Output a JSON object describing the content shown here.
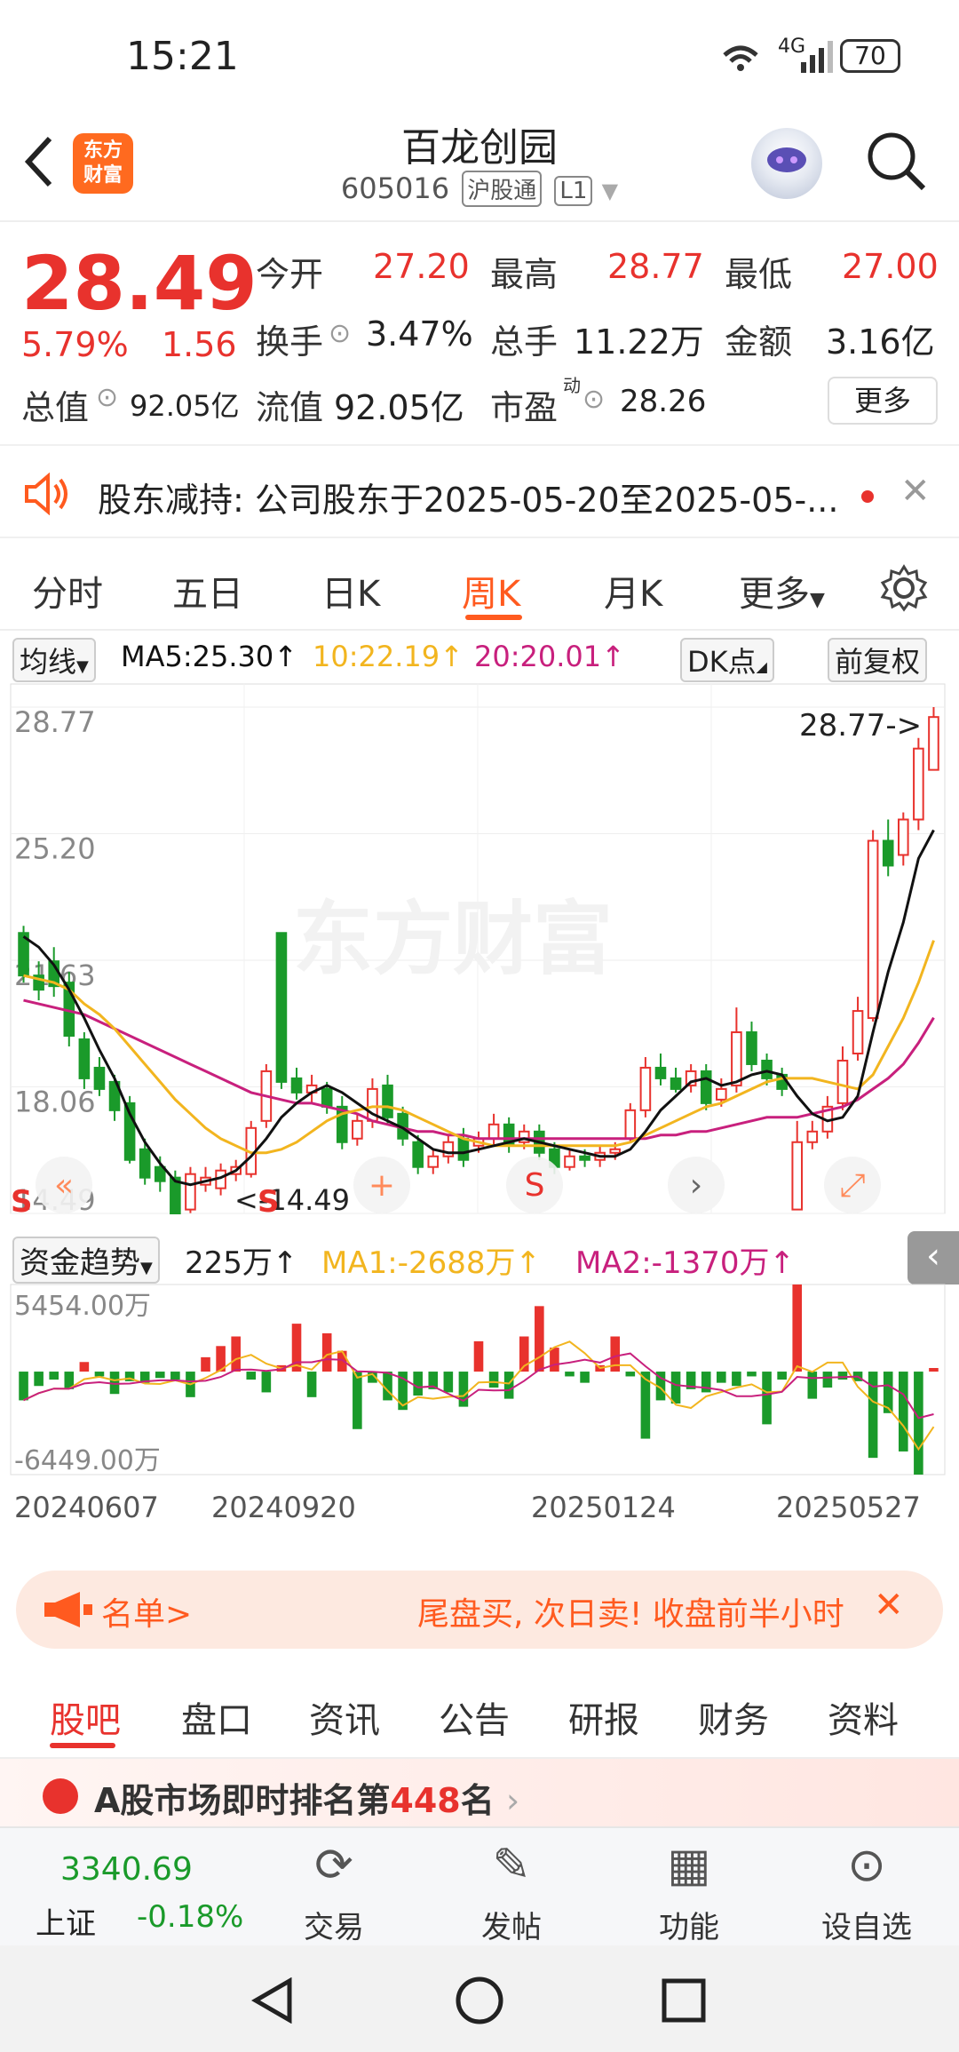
{
  "status": {
    "time": "15:21",
    "network": "4G",
    "battery": "70"
  },
  "header": {
    "logo_text_1": "东方",
    "logo_text_2": "财富",
    "title": "百龙创园",
    "code": "605016",
    "tag1": "沪股通",
    "tag2": "L1"
  },
  "quote": {
    "price": "28.49",
    "change_pct": "5.79%",
    "change": "1.56",
    "open_label": "今开",
    "open": "27.20",
    "high_label": "最高",
    "high": "28.77",
    "low_label": "最低",
    "low": "27.00",
    "turnover_label": "换手",
    "turnover": "3.47%",
    "volume_label": "总手",
    "volume": "11.22万",
    "amount_label": "金额",
    "amount": "3.16亿",
    "mcap_label": "总值",
    "mcap": "92.05亿",
    "float_label": "流值",
    "float": "92.05亿",
    "pe_label": "市盈",
    "pe_sup": "动",
    "pe": "28.26",
    "more": "更多"
  },
  "notice": {
    "text": "股东减持:   公司股东于2025-05-20至2025-05-..."
  },
  "ktabs": [
    "分时",
    "五日",
    "日K",
    "周K",
    "月K",
    "更多"
  ],
  "chart_header": {
    "ma_label": "均线",
    "ma5": "MA5:25.30↑",
    "ma10": "10:22.19↑",
    "ma20": "20:20.01↑",
    "dk": "DK点",
    "adj": "前复权"
  },
  "chart_data": [
    {
      "type": "candlestick",
      "y_axis_labels": [
        "28.77",
        "25.20",
        "21.63",
        "18.06",
        "14.49"
      ],
      "ylim": [
        14.49,
        28.77
      ],
      "annotations": [
        "28.77->",
        "<-14.49"
      ],
      "x_labels": [
        "20240607",
        "20240920",
        "20250124",
        "20250527"
      ],
      "candles": [
        [
          22.4,
          21.2,
          22.6,
          21.0
        ],
        [
          21.2,
          20.8,
          21.6,
          20.5
        ],
        [
          21.6,
          20.9,
          22.0,
          20.6
        ],
        [
          21.0,
          19.5,
          21.3,
          19.2
        ],
        [
          19.4,
          18.3,
          19.6,
          18.0
        ],
        [
          18.6,
          18.0,
          18.9,
          17.8
        ],
        [
          18.2,
          17.4,
          18.4,
          17.1
        ],
        [
          17.6,
          16.0,
          17.8,
          15.9
        ],
        [
          16.3,
          15.5,
          16.6,
          15.3
        ],
        [
          15.8,
          15.4,
          16.1,
          15.1
        ],
        [
          15.5,
          14.49,
          15.7,
          14.49
        ],
        [
          14.6,
          15.6,
          15.8,
          14.5
        ],
        [
          15.3,
          15.5,
          15.8,
          15.1
        ],
        [
          15.2,
          15.7,
          15.9,
          15.0
        ],
        [
          15.6,
          15.8,
          16.0,
          15.4
        ],
        [
          15.6,
          16.9,
          17.1,
          15.5
        ],
        [
          17.1,
          18.5,
          18.7,
          16.9
        ],
        [
          22.4,
          18.2,
          22.4,
          18.0
        ],
        [
          18.3,
          17.9,
          18.6,
          17.7
        ],
        [
          17.9,
          18.1,
          18.4,
          17.6
        ],
        [
          18.0,
          17.5,
          18.2,
          17.3
        ],
        [
          17.5,
          16.5,
          17.8,
          16.3
        ],
        [
          16.6,
          17.1,
          17.3,
          16.4
        ],
        [
          17.1,
          18.0,
          18.3,
          16.9
        ],
        [
          18.1,
          17.2,
          18.4,
          17.0
        ],
        [
          17.3,
          16.6,
          17.5,
          16.4
        ],
        [
          16.5,
          15.8,
          16.7,
          15.6
        ],
        [
          15.8,
          16.1,
          16.3,
          15.6
        ],
        [
          16.1,
          16.5,
          16.7,
          15.9
        ],
        [
          16.6,
          16.0,
          16.9,
          15.8
        ],
        [
          16.4,
          16.6,
          16.8,
          16.2
        ],
        [
          16.6,
          17.0,
          17.3,
          16.4
        ],
        [
          17.0,
          16.4,
          17.2,
          16.2
        ],
        [
          16.5,
          16.8,
          17.0,
          16.3
        ],
        [
          16.8,
          16.2,
          17.0,
          16.0
        ],
        [
          16.3,
          15.8,
          16.5,
          15.6
        ],
        [
          15.8,
          16.1,
          16.3,
          15.7
        ],
        [
          16.1,
          16.0,
          16.3,
          15.8
        ],
        [
          16.0,
          16.2,
          16.4,
          15.8
        ],
        [
          16.2,
          16.3,
          16.5,
          16.0
        ],
        [
          16.6,
          17.4,
          17.6,
          16.5
        ],
        [
          17.4,
          18.6,
          18.9,
          17.2
        ],
        [
          18.6,
          18.3,
          19.0,
          18.1
        ],
        [
          18.3,
          18.0,
          18.6,
          17.9
        ],
        [
          18.1,
          18.5,
          18.7,
          17.9
        ],
        [
          18.5,
          17.6,
          18.7,
          17.4
        ],
        [
          17.7,
          18.0,
          18.3,
          17.5
        ],
        [
          18.1,
          19.6,
          20.3,
          17.9
        ],
        [
          19.6,
          18.7,
          19.9,
          18.5
        ],
        [
          18.8,
          18.3,
          19.0,
          18.1
        ],
        [
          18.4,
          18.0,
          18.6,
          17.8
        ],
        [
          14.6,
          16.5,
          17.1,
          14.6
        ],
        [
          16.5,
          16.8,
          17.1,
          16.3
        ],
        [
          16.8,
          17.5,
          17.8,
          16.6
        ],
        [
          17.6,
          18.8,
          19.2,
          17.4
        ],
        [
          19.0,
          20.2,
          20.6,
          18.8
        ],
        [
          20.0,
          25.0,
          25.3,
          19.9
        ],
        [
          25.0,
          24.3,
          25.6,
          24.0
        ],
        [
          24.6,
          25.6,
          25.8,
          24.3
        ],
        [
          25.6,
          27.6,
          27.9,
          25.3
        ],
        [
          27.0,
          28.49,
          28.77,
          27.0
        ]
      ],
      "ma5": [
        22.3,
        22.0,
        21.5,
        20.8,
        20.0,
        19.1,
        18.3,
        17.3,
        16.5,
        15.9,
        15.4,
        15.3,
        15.4,
        15.5,
        15.7,
        16.1,
        16.6,
        17.2,
        17.6,
        17.9,
        18.1,
        17.9,
        17.6,
        17.3,
        17.1,
        16.9,
        16.6,
        16.3,
        16.2,
        16.2,
        16.3,
        16.4,
        16.5,
        16.6,
        16.5,
        16.4,
        16.3,
        16.2,
        16.1,
        16.1,
        16.3,
        16.8,
        17.4,
        17.8,
        18.2,
        18.3,
        18.1,
        18.2,
        18.4,
        18.5,
        18.4,
        17.8,
        17.3,
        17.1,
        17.2,
        17.8,
        19.6,
        21.3,
        22.7,
        24.5,
        25.3
      ],
      "ma10": [
        21.2,
        21.1,
        21.0,
        20.8,
        20.4,
        20.1,
        19.7,
        19.2,
        18.7,
        18.2,
        17.7,
        17.3,
        16.9,
        16.6,
        16.4,
        16.2,
        16.2,
        16.3,
        16.5,
        16.8,
        17.1,
        17.3,
        17.4,
        17.5,
        17.5,
        17.4,
        17.2,
        17.0,
        16.8,
        16.6,
        16.5,
        16.4,
        16.4,
        16.4,
        16.4,
        16.4,
        16.4,
        16.4,
        16.4,
        16.4,
        16.5,
        16.7,
        16.9,
        17.1,
        17.3,
        17.5,
        17.6,
        17.8,
        18.0,
        18.2,
        18.3,
        18.3,
        18.3,
        18.2,
        18.1,
        18.0,
        18.4,
        19.2,
        20.0,
        21.0,
        22.19
      ],
      "ma20": [
        20.5,
        20.4,
        20.3,
        20.2,
        20.1,
        19.9,
        19.7,
        19.5,
        19.3,
        19.1,
        18.9,
        18.7,
        18.5,
        18.3,
        18.1,
        17.9,
        17.8,
        17.7,
        17.6,
        17.6,
        17.5,
        17.4,
        17.3,
        17.1,
        17.0,
        16.9,
        16.8,
        16.8,
        16.7,
        16.7,
        16.6,
        16.6,
        16.6,
        16.6,
        16.6,
        16.6,
        16.6,
        16.6,
        16.6,
        16.6,
        16.6,
        16.6,
        16.7,
        16.7,
        16.8,
        16.8,
        16.9,
        17.0,
        17.1,
        17.2,
        17.2,
        17.2,
        17.3,
        17.4,
        17.5,
        17.7,
        18.0,
        18.3,
        18.7,
        19.3,
        20.01
      ]
    },
    {
      "type": "bar",
      "name": "资金趋势",
      "value_label": "225万↑",
      "ma1": "MA1:-2688万↑",
      "ma2": "MA2:-1370万↑",
      "y_axis_labels": [
        "5454.00万",
        "-6449.00万"
      ],
      "ylim": [
        -6449,
        5454
      ],
      "values": [
        -1800,
        -900,
        -500,
        -1100,
        600,
        -300,
        -1400,
        -600,
        -700,
        -400,
        -500,
        -1600,
        900,
        1600,
        2200,
        -500,
        -1300,
        400,
        3000,
        -1600,
        2400,
        1300,
        -3600,
        -700,
        -1800,
        -2400,
        -1500,
        -1100,
        -1300,
        -2200,
        1900,
        -1000,
        -1700,
        2200,
        4100,
        1500,
        -300,
        -700,
        400,
        2200,
        -300,
        -4200,
        -1800,
        -2000,
        -1100,
        -1300,
        -700,
        -900,
        -300,
        -3300,
        -500,
        5454,
        -1700,
        -1000,
        -500,
        -600,
        -5400,
        -2600,
        -5000,
        -6449,
        225
      ]
    }
  ],
  "chart_controls": {
    "left": "«",
    "plus": "+",
    "s": "S",
    "next": "›",
    "expand": "⤢"
  },
  "banner": {
    "left": "名单>",
    "text": "尾盘买, 次日卖! 收盘前半小时",
    "close": "✕"
  },
  "btabs": [
    "股吧",
    "盘口",
    "资讯",
    "公告",
    "研报",
    "财务",
    "资料"
  ],
  "rank": {
    "text_pre": "A股市场即时排名第",
    "rank": "448",
    "text_post": "名"
  },
  "footer": {
    "index_value": "3340.69",
    "index_name": "上证",
    "index_change": "-0.18%",
    "items": [
      "交易",
      "发帖",
      "功能",
      "设自选"
    ]
  },
  "colors": {
    "up": "#e8322d",
    "down": "#1a9a2a",
    "ma5": "#111111",
    "ma10": "#f2b51f",
    "ma20": "#c8207d",
    "accent": "#ff5a1f"
  }
}
